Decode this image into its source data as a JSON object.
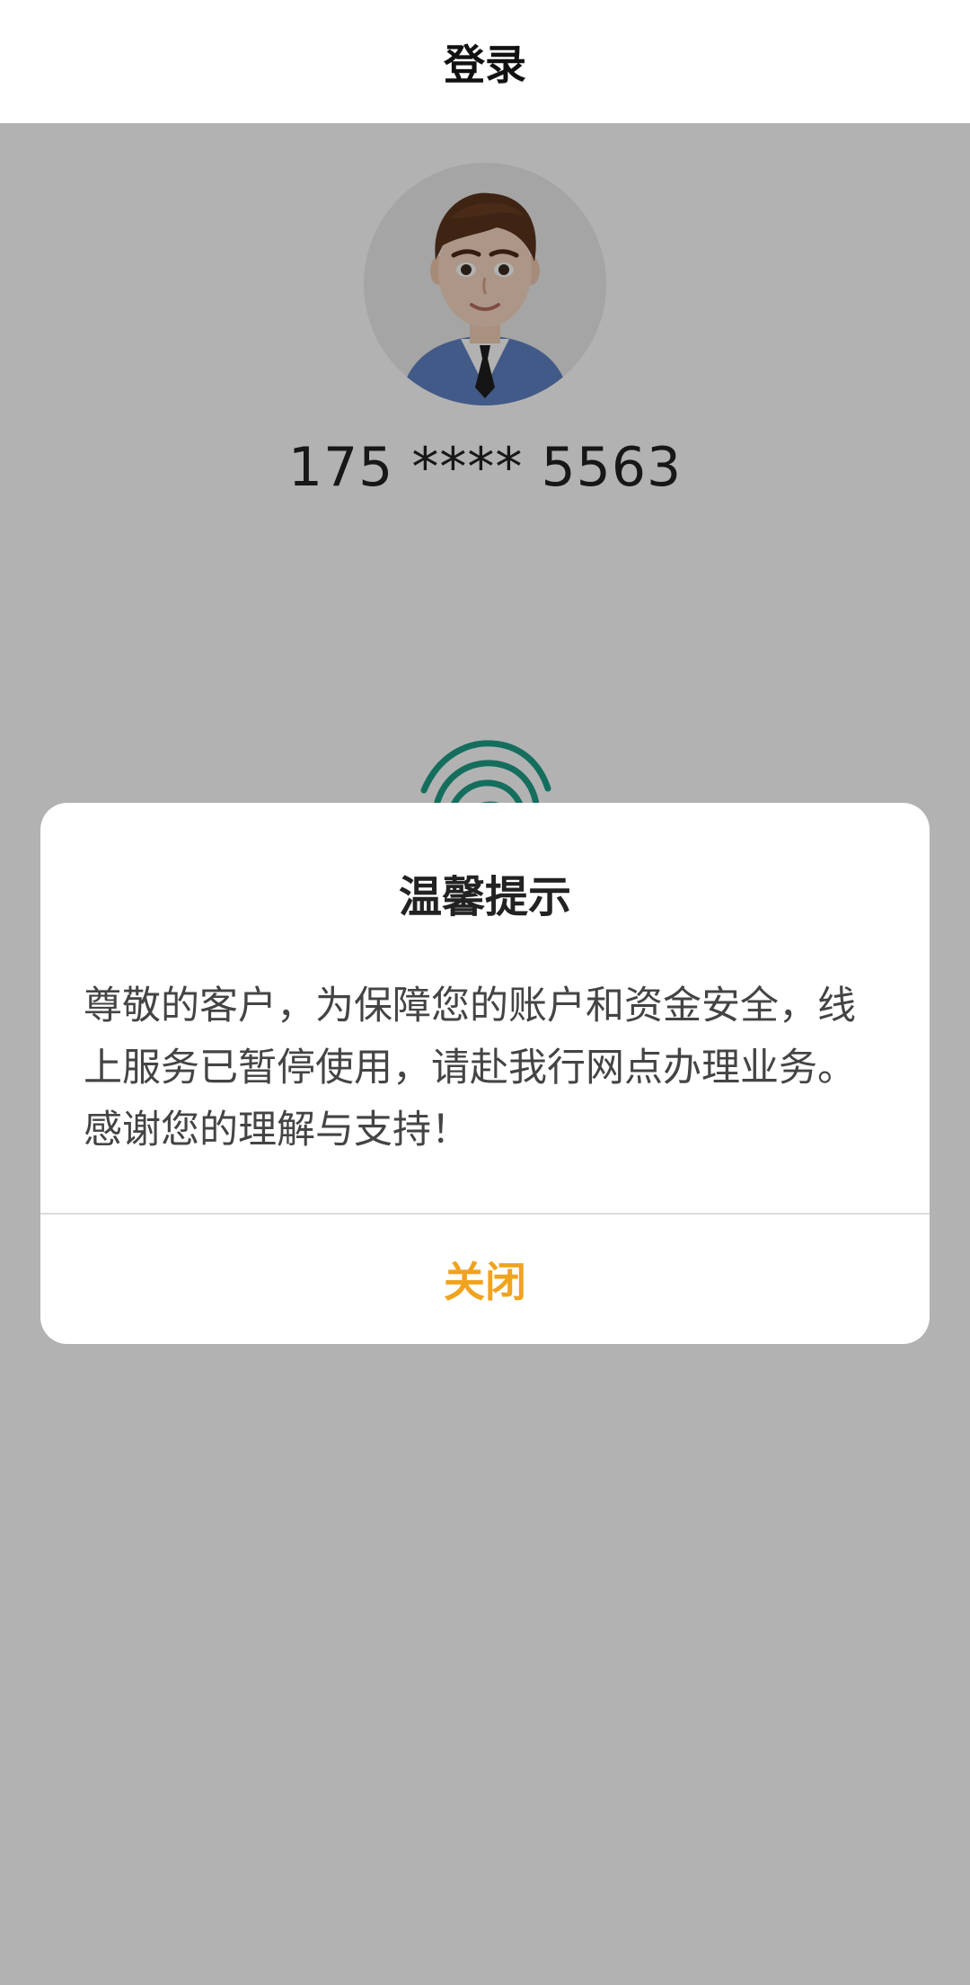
{
  "header": {
    "title": "登录"
  },
  "account": {
    "phone_masked": "175 **** 5563"
  },
  "icons": {
    "avatar": "avatar-icon",
    "fingerprint": "fingerprint-icon"
  },
  "dialog": {
    "title": "温馨提示",
    "message": "尊敬的客户，为保障您的账户和资金安全，线上服务已暂停使用，请赴我行网点办理业务。感谢您的理解与支持！",
    "close_label": "关闭"
  },
  "colors": {
    "accent": "#F0A31E",
    "fingerprint": "#1F9E86",
    "overlay": "#000000"
  }
}
